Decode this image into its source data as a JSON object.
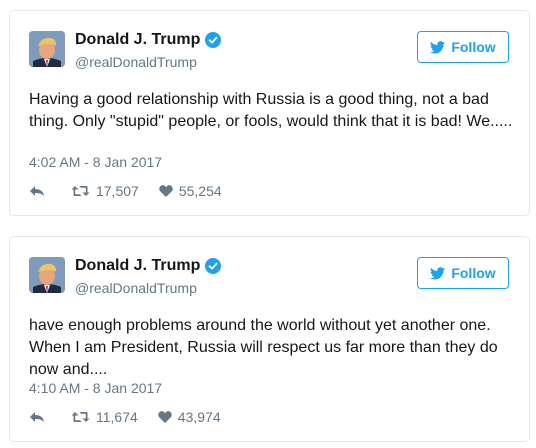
{
  "tweets": [
    {
      "author_name": "Donald J. Trump",
      "handle": "@realDonaldTrump",
      "follow_label": "Follow",
      "text": "Having a good relationship with Russia is a good thing, not a bad thing. Only \"stupid\" people, or fools, would think that it is bad! We.....",
      "timestamp": "4:02 AM - 8 Jan 2017",
      "retweets": "17,507",
      "likes": "55,254"
    },
    {
      "author_name": "Donald J. Trump",
      "handle": "@realDonaldTrump",
      "follow_label": "Follow",
      "text": "have enough problems around the world without yet another one. When I am President, Russia will respect us far more than they do now and....",
      "timestamp": "4:10 AM - 8 Jan 2017",
      "retweets": "11,674",
      "likes": "43,974"
    }
  ],
  "icons": {
    "verified": "verified-badge-icon",
    "follow": "twitter-bird-icon",
    "reply": "reply-icon",
    "retweet": "retweet-icon",
    "like": "heart-icon"
  },
  "colors": {
    "accent": "#1da1f2",
    "secondary_text": "#657786",
    "primary_text": "#14171a",
    "border": "#e1e8ed"
  }
}
